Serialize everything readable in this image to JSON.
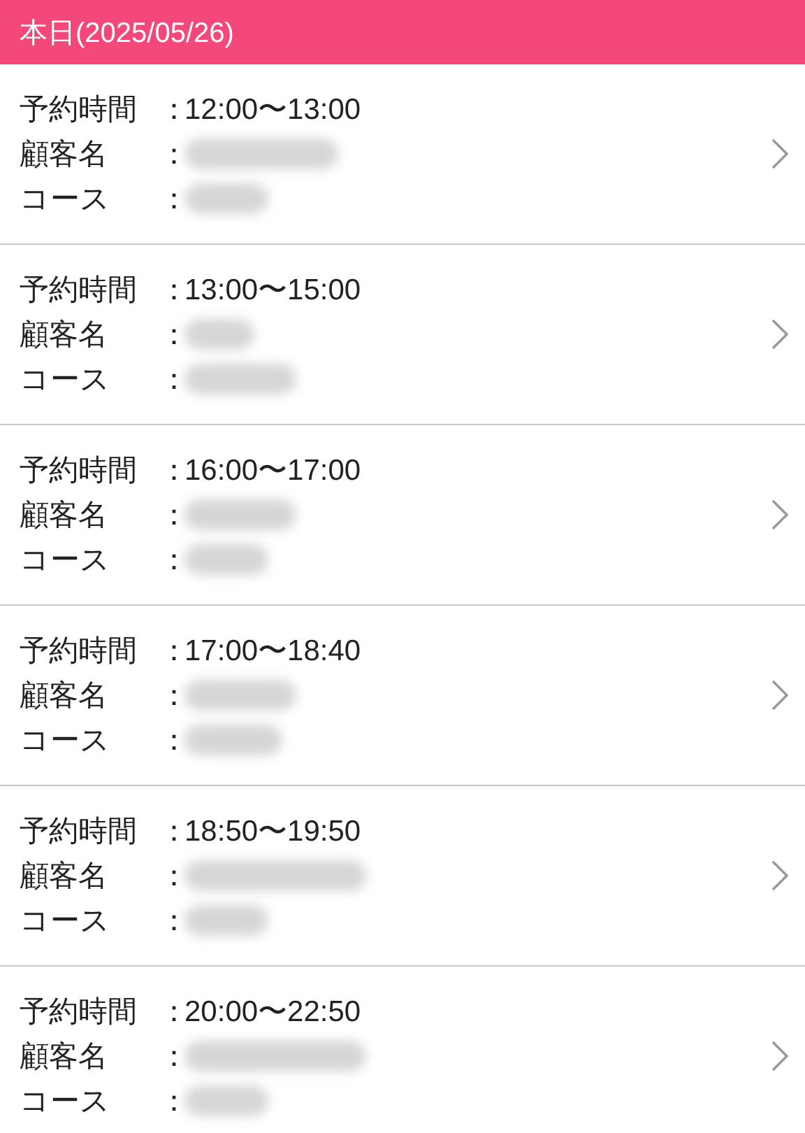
{
  "header": {
    "title": "本日(2025/05/26)"
  },
  "reservations": [
    {
      "time_label": "予約時間",
      "time_sep": "：",
      "time": "12:00〜13:00",
      "customer_label": "顧客名",
      "customer_sep": "：",
      "course_label": "コース",
      "course_sep": "："
    },
    {
      "time_label": "予約時間",
      "time_sep": "：",
      "time": "13:00〜15:00",
      "customer_label": "顧客名",
      "customer_sep": "：",
      "course_label": "コース",
      "course_sep": "："
    },
    {
      "time_label": "予約時間",
      "time_sep": "：",
      "time": "16:00〜17:00",
      "customer_label": "顧客名",
      "customer_sep": "：",
      "course_label": "コース",
      "course_sep": "："
    },
    {
      "time_label": "予約時間",
      "time_sep": "：",
      "time": "17:00〜18:40",
      "customer_label": "顧客名",
      "customer_sep": "：",
      "course_label": "コース",
      "course_sep": "："
    },
    {
      "time_label": "予約時間",
      "time_sep": "：",
      "time": "18:50〜19:50",
      "customer_label": "顧客名",
      "customer_sep": "：",
      "course_label": "コース",
      "course_sep": "："
    },
    {
      "time_label": "予約時間",
      "time_sep": "：",
      "time": "20:00〜22:50",
      "customer_label": "顧客名",
      "customer_sep": "：",
      "course_label": "コース",
      "course_sep": "："
    }
  ]
}
